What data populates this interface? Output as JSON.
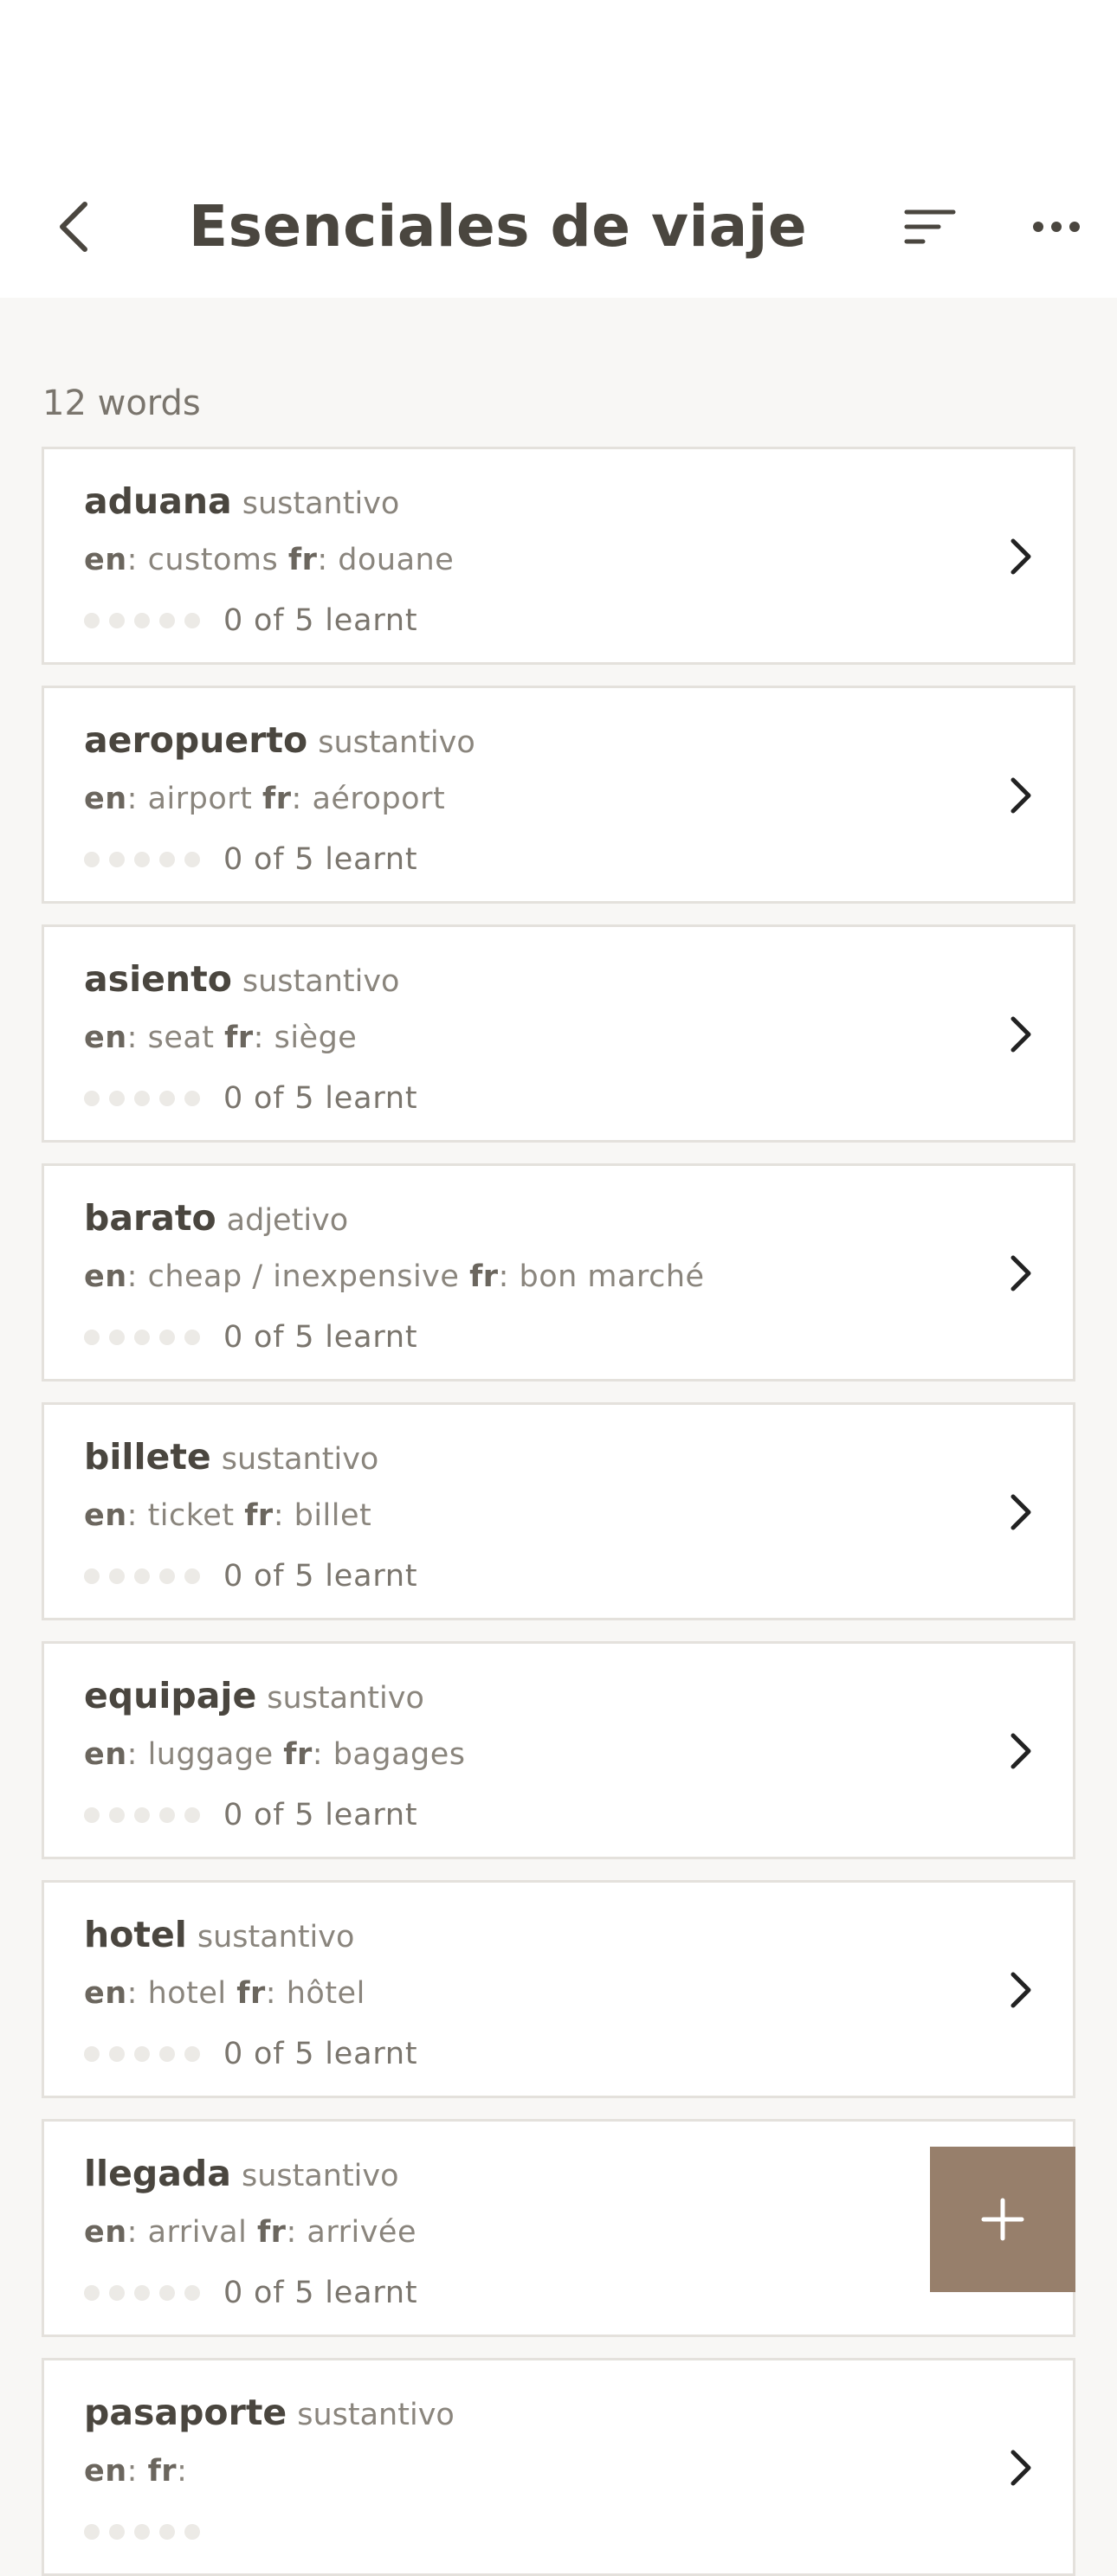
{
  "header": {
    "title": "Esenciales de viaje",
    "back_icon": "chevron-left-icon",
    "sort_icon": "sort-lines-icon",
    "more_icon": "more-horizontal-icon"
  },
  "list": {
    "count_label": "12 words",
    "lang1": "en",
    "lang2": "fr",
    "items": [
      {
        "word": "aduana",
        "pos": "sustantivo",
        "en": "customs",
        "fr": "douane",
        "learnt": 0,
        "total": 5,
        "progress": "0 of 5 learnt"
      },
      {
        "word": "aeropuerto",
        "pos": "sustantivo",
        "en": "airport",
        "fr": "aéroport",
        "learnt": 0,
        "total": 5,
        "progress": "0 of 5 learnt"
      },
      {
        "word": "asiento",
        "pos": "sustantivo",
        "en": "seat",
        "fr": "siège",
        "learnt": 0,
        "total": 5,
        "progress": "0 of 5 learnt"
      },
      {
        "word": "barato",
        "pos": "adjetivo",
        "en": "cheap / inexpensive",
        "fr": "bon marché",
        "learnt": 0,
        "total": 5,
        "progress": "0 of 5 learnt"
      },
      {
        "word": "billete",
        "pos": "sustantivo",
        "en": "ticket",
        "fr": "billet",
        "learnt": 0,
        "total": 5,
        "progress": "0 of 5 learnt"
      },
      {
        "word": "equipaje",
        "pos": "sustantivo",
        "en": "luggage",
        "fr": "bagages",
        "learnt": 0,
        "total": 5,
        "progress": "0 of 5 learnt"
      },
      {
        "word": "hotel",
        "pos": "sustantivo",
        "en": "hotel",
        "fr": "hôtel",
        "learnt": 0,
        "total": 5,
        "progress": "0 of 5 learnt"
      },
      {
        "word": "llegada",
        "pos": "sustantivo",
        "en": "arrival",
        "fr": "arrivée",
        "learnt": 0,
        "total": 5,
        "progress": "0 of 5 learnt"
      },
      {
        "word": "pasaporte",
        "pos": "sustantivo",
        "en": "",
        "fr": "",
        "learnt": 0,
        "total": 5,
        "progress": ""
      }
    ]
  },
  "fab": {
    "icon": "plus-icon"
  },
  "colors": {
    "background": "#f8f7f5",
    "card": "#ffffff",
    "card_border": "#e4e1dc",
    "title_text": "#4a463f",
    "muted_text": "#8a857d",
    "dot_empty": "#eceae6",
    "accent": "#977f6b"
  }
}
